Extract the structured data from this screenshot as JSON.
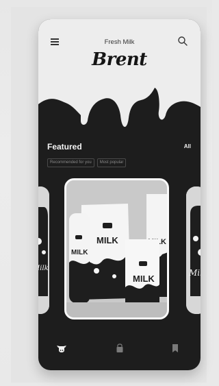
{
  "header": {
    "subtitle": "Fresh Milk",
    "brand": "Brent"
  },
  "section": {
    "title": "Featured",
    "all_label": "All",
    "chips": [
      "Recommended for you",
      "Most popular"
    ]
  },
  "product_labels": {
    "main_front": "MILK",
    "main_left": "MILK",
    "main_right": "MILK",
    "main_back": "MILK",
    "side_left": "Milk",
    "side_right": "Milk"
  },
  "bottom_nav": [
    "cow-icon",
    "bag-icon",
    "bookmark-icon"
  ],
  "colors": {
    "background": "#e9e9e9",
    "phone_dark": "#1d1d1d",
    "phone_light": "#ededed"
  }
}
